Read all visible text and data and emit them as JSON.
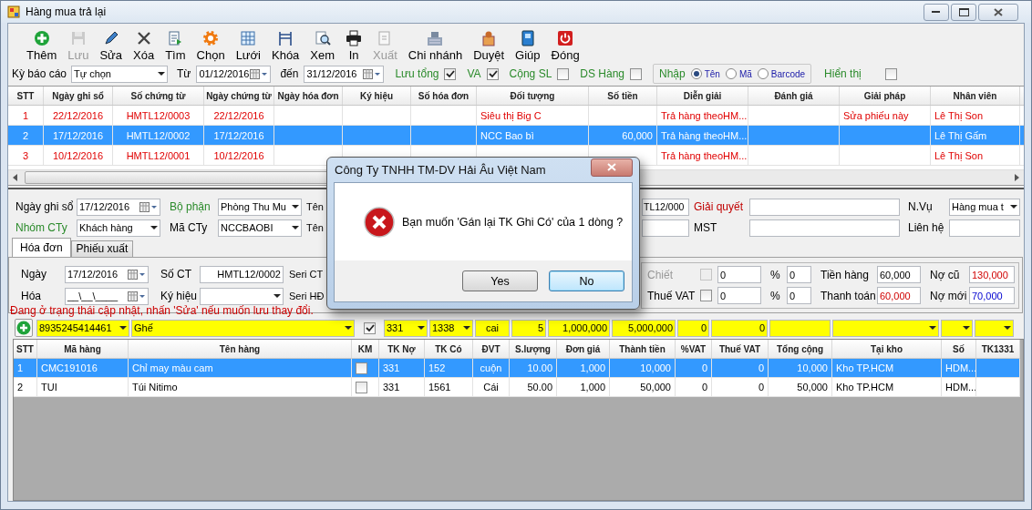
{
  "window": {
    "title": "Hàng mua trả lại"
  },
  "toolbar": [
    {
      "kind": "add",
      "label": "Thêm",
      "disabled": false
    },
    {
      "kind": "save",
      "label": "Lưu",
      "disabled": true
    },
    {
      "kind": "edit",
      "label": "Sửa",
      "disabled": false
    },
    {
      "kind": "delete",
      "label": "Xóa",
      "disabled": false
    },
    {
      "kind": "find",
      "label": "Tìm",
      "disabled": false
    },
    {
      "kind": "choose",
      "label": "Chọn",
      "disabled": false
    },
    {
      "kind": "grid",
      "label": "Lưới",
      "disabled": false
    },
    {
      "kind": "lock",
      "label": "Khóa",
      "disabled": false
    },
    {
      "kind": "preview",
      "label": "Xem",
      "disabled": false
    },
    {
      "kind": "print",
      "label": "In",
      "disabled": false
    },
    {
      "kind": "export",
      "label": "Xuất",
      "disabled": true
    },
    {
      "kind": "branch",
      "label": "Chi nhánh",
      "disabled": false
    },
    {
      "kind": "approve",
      "label": "Duyệt",
      "disabled": false
    },
    {
      "kind": "help",
      "label": "Giúp",
      "disabled": false
    },
    {
      "kind": "close",
      "label": "Đóng",
      "disabled": false
    }
  ],
  "filter": {
    "period": {
      "label": "Kỳ báo cáo",
      "value": "Tự chọn"
    },
    "from": {
      "label": "Từ",
      "value": "01/12/2016"
    },
    "to": {
      "label": "đến",
      "value": "31/12/2016"
    },
    "options": [
      {
        "label": "Lưu tổng",
        "checked": true
      },
      {
        "label": "VA",
        "checked": true
      },
      {
        "label": "Cộng SL",
        "checked": false
      },
      {
        "label": "DS Hàng",
        "checked": false
      }
    ],
    "input_mode": {
      "label": "Nhập",
      "choices": [
        {
          "label": "Tên",
          "selected": true
        },
        {
          "label": "Mã",
          "selected": false
        },
        {
          "label": "Barcode",
          "selected": false
        }
      ]
    },
    "show": {
      "label": "Hiển thị",
      "checked": false
    }
  },
  "vouchers": {
    "columns": [
      "STT",
      "Ngày ghi sổ",
      "Số chứng từ",
      "Ngày chứng từ",
      "Ngày hóa đơn",
      "Ký hiệu",
      "Số hóa đơn",
      "Đối tượng",
      "Số tiền",
      "Diễn giải",
      "Đánh giá",
      "Giải pháp",
      "Nhân viên"
    ],
    "rows": [
      {
        "selected": false,
        "flagged": true,
        "cells": [
          "1",
          "22/12/2016",
          "HMTL12/0003",
          "22/12/2016",
          null,
          null,
          null,
          "Siêu thị Big C",
          null,
          "Trả hàng theoHM...",
          null,
          "Sửa phiếu này",
          "Lê Thị Son"
        ]
      },
      {
        "selected": true,
        "flagged": false,
        "cells": [
          "2",
          "17/12/2016",
          "HMTL12/0002",
          "17/12/2016",
          null,
          null,
          null,
          "NCC Bao bì",
          "60,000",
          "Trả hàng theoHM...",
          null,
          null,
          "Lê Thị Gấm"
        ]
      },
      {
        "selected": false,
        "flagged": true,
        "cells": [
          "3",
          "10/12/2016",
          "HMTL12/0001",
          "10/12/2016",
          null,
          null,
          null,
          null,
          null,
          "Trả hàng theoHM...",
          null,
          null,
          "Lê Thị Son"
        ]
      }
    ]
  },
  "form": {
    "posting_date": {
      "label": "Ngày ghi sổ",
      "value": "17/12/2016"
    },
    "department": {
      "label": "Bộ phận",
      "value": "Phòng Thu Mu"
    },
    "company_group": {
      "label": "Nhóm CTy",
      "value": "Khách hàng"
    },
    "company_code": {
      "label": "Mã CTy",
      "value": "NCCBAOBI"
    },
    "name_labels": [
      "Tên",
      "Tên"
    ],
    "column_5_value": "TL12/000",
    "resolution": {
      "label": "Giải quyết"
    },
    "tax_code": {
      "label": "MST"
    },
    "operation": {
      "label": "N.Vụ",
      "value": "Hàng mua t"
    },
    "contact": {
      "label": "Liên hệ"
    }
  },
  "tabs": [
    {
      "label": "Hóa đơn",
      "selected": true
    },
    {
      "label": "Phiếu xuất",
      "selected": false
    }
  ],
  "invoice": {
    "date": {
      "label": "Ngày",
      "value": "17/12/2016"
    },
    "voucher_no": {
      "label": "Số CT",
      "value": "HMTL12/0002"
    },
    "voucher_series": {
      "label": "Seri CT"
    },
    "invoice_date": {
      "label": "Hóa",
      "value": "__\\__\\____"
    },
    "symbol": {
      "label": "Ký hiệu"
    },
    "invoice_series": {
      "label": "Seri HĐ"
    }
  },
  "adjustments": [
    {
      "label": "Chiết",
      "disabled": true,
      "checked": false,
      "amount": "0",
      "percent_sign": "%",
      "percent": "0"
    },
    {
      "label": "Thuế VAT",
      "disabled": false,
      "checked": false,
      "amount": "0",
      "percent_sign": "%",
      "percent": "0"
    }
  ],
  "balances": [
    {
      "label": "Tiền hàng",
      "value": "60,000",
      "kind": "plain"
    },
    {
      "label": "Nợ cũ",
      "value": "130,000",
      "kind": "alert"
    },
    {
      "label": "Thanh toán",
      "value": "60,000",
      "kind": "alert"
    },
    {
      "label": "Nợ mới",
      "value": "70,000",
      "kind": "info"
    }
  ],
  "status_message": "Đang ở trạng thái cập nhật, nhấn 'Sửa' nếu muốn lưu thay đổi.",
  "entry": {
    "barcode": "8935245414461",
    "item": "Ghế",
    "promo": true,
    "debit": "331",
    "credit": "1338",
    "unit": "cai",
    "quantity": "5",
    "price": "1,000,000",
    "amount": "5,000,000",
    "vat_rate": "0",
    "vat": "0"
  },
  "lines": {
    "columns": [
      "STT",
      "Mã hàng",
      "Tên hàng",
      "KM",
      "TK Nợ",
      "TK Có",
      "ĐVT",
      "S.lượng",
      "Đơn giá",
      "Thành tiền",
      "%VAT",
      "Thuế VAT",
      "Tổng cộng",
      "Tại kho",
      "Số",
      "TK1331"
    ],
    "rows": [
      {
        "selected": true,
        "promo": false,
        "cells": [
          "1",
          "CMC191016",
          "Chỉ may màu cam",
          null,
          "331",
          "152",
          "cuộn",
          "10.00",
          "1,000",
          "10,000",
          "0",
          "0",
          "10,000",
          "Kho TP.HCM",
          "HDM...",
          null
        ]
      },
      {
        "selected": false,
        "promo": false,
        "cells": [
          "2",
          "TUI",
          "Túi Nitimo",
          null,
          "331",
          "1561",
          "Cái",
          "50.00",
          "1,000",
          "50,000",
          "0",
          "0",
          "50,000",
          "Kho TP.HCM",
          "HDM...",
          null
        ]
      }
    ]
  },
  "dialog": {
    "title": "Công Ty TNHH TM-DV Hải Âu Việt Nam",
    "message": "Bạn muốn 'Gán lại TK Ghi Có' của 1 dòng ?",
    "buttons": [
      {
        "label": "Yes",
        "focused": false
      },
      {
        "label": "No",
        "focused": true
      }
    ]
  }
}
